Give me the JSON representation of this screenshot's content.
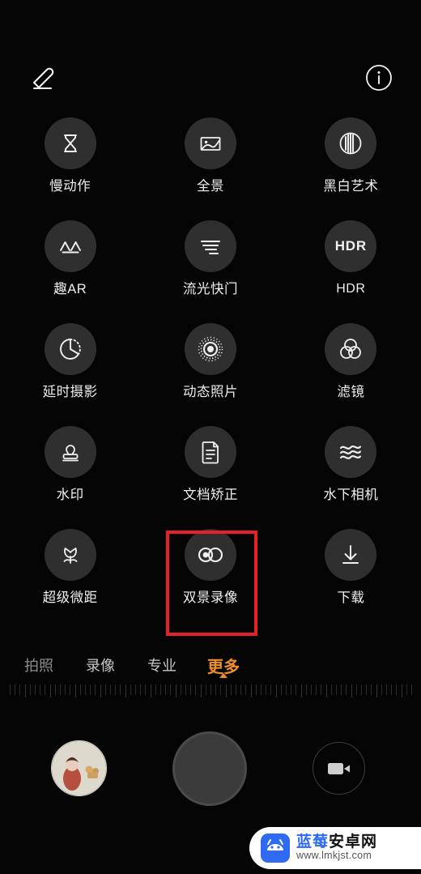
{
  "app": {
    "title": "相机 - 更多",
    "accent_orange": "#ef8f29",
    "highlight_red": "#e8202a",
    "bubble_bg": "#2f2f2f",
    "background": "#050505"
  },
  "topbar": {
    "edit_icon": "pencil-edit-icon",
    "info_icon": "info-circle-icon"
  },
  "modes": {
    "rows": [
      [
        {
          "label": "慢动作",
          "icon": "hourglass-icon",
          "latin": false,
          "highlighted": false
        },
        {
          "label": "全景",
          "icon": "panorama-icon",
          "latin": false,
          "highlighted": false
        },
        {
          "label": "黑白艺术",
          "icon": "black-white-art-icon",
          "latin": false,
          "highlighted": false
        }
      ],
      [
        {
          "label": "趣AR",
          "icon": "ar-icon",
          "latin": false,
          "highlighted": false
        },
        {
          "label": "流光快门",
          "icon": "light-painting-icon",
          "latin": false,
          "highlighted": false
        },
        {
          "label": "HDR",
          "icon": "hdr-icon",
          "latin": true,
          "highlighted": false
        }
      ],
      [
        {
          "label": "延时摄影",
          "icon": "time-lapse-icon",
          "latin": false,
          "highlighted": false
        },
        {
          "label": "动态照片",
          "icon": "live-photo-icon",
          "latin": false,
          "highlighted": false
        },
        {
          "label": "滤镜",
          "icon": "filter-rings-icon",
          "latin": false,
          "highlighted": false
        }
      ],
      [
        {
          "label": "水印",
          "icon": "stamp-watermark-icon",
          "latin": false,
          "highlighted": false
        },
        {
          "label": "文档矫正",
          "icon": "document-correction-icon",
          "latin": false,
          "highlighted": false
        },
        {
          "label": "水下相机",
          "icon": "underwater-waves-icon",
          "latin": false,
          "highlighted": false
        }
      ],
      [
        {
          "label": "超级微距",
          "icon": "macro-flower-icon",
          "latin": false,
          "highlighted": false
        },
        {
          "label": "双景录像",
          "icon": "dual-view-video-icon",
          "latin": false,
          "highlighted": true
        },
        {
          "label": "下载",
          "icon": "download-arrow-icon",
          "latin": false,
          "highlighted": false
        }
      ]
    ]
  },
  "tabs": {
    "items": [
      {
        "label": "拍照",
        "active": false
      },
      {
        "label": "录像",
        "active": false
      },
      {
        "label": "专业",
        "active": false
      },
      {
        "label": "更多",
        "active": true
      }
    ]
  },
  "bottom": {
    "gallery_thumb_name": "gallery-thumbnail",
    "shutter_name": "shutter-button",
    "video_toggle_icon": "camcorder-icon"
  },
  "watermark": {
    "brand_cn_blue": "蓝莓",
    "brand_cn_black": "安卓网",
    "url": "www.lmkjst.com",
    "logo_icon": "android-mascot-icon"
  }
}
